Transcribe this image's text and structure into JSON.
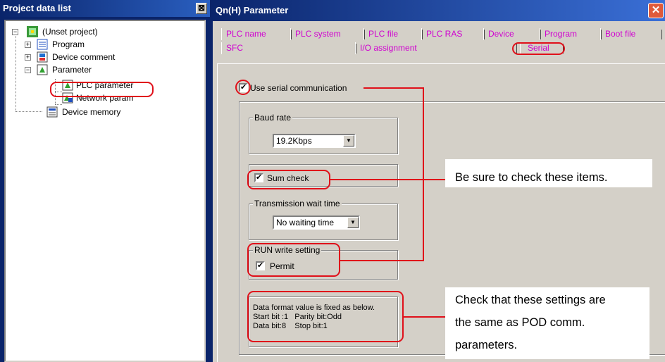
{
  "left_panel": {
    "title": "Project data list",
    "close_glyph": "⊠",
    "tree": [
      {
        "label": "(Unset project)",
        "icon": "project-icon",
        "expander": "−"
      },
      {
        "label": "Program",
        "icon": "program-icon",
        "expander": "+"
      },
      {
        "label": "Device comment",
        "icon": "device-comment-icon",
        "expander": "+"
      },
      {
        "label": "Parameter",
        "icon": "parameter-icon",
        "expander": "−"
      },
      {
        "label": "PLC parameter",
        "icon": "plc-parameter-icon"
      },
      {
        "label": "Network param",
        "icon": "network-param-icon"
      },
      {
        "label": "Device memory",
        "icon": "device-memory-icon"
      }
    ]
  },
  "dialog": {
    "title": "Qn(H) Parameter",
    "close_glyph": "✕",
    "tabs_row1": [
      "PLC name",
      "PLC system",
      "PLC file",
      "PLC RAS",
      "Device",
      "Program",
      "Boot file"
    ],
    "tabs_row2": [
      "SFC",
      "I/O assignment",
      "Serial"
    ],
    "active_tab": "Serial",
    "use_serial_label": "Use serial communication",
    "baud_rate": {
      "group_label": "Baud rate",
      "value": "19.2Kbps"
    },
    "sum_check_label": "Sum check",
    "transmission_wait": {
      "group_label": "Transmission wait time",
      "value": "No waiting time"
    },
    "run_write": {
      "group_label": "RUN write setting",
      "permit_label": "Permit"
    },
    "data_format": {
      "line1": "Data format value is fixed as below.",
      "line2": "Start bit :1   Parity bit:Odd",
      "line3": "Data bit:8    Stop bit:1"
    }
  },
  "annotations": {
    "note_check_items": "Be sure to check these items.",
    "note_settings_1": "Check that these settings are",
    "note_settings_2": "the same as POD comm.",
    "note_settings_3": "parameters.",
    "accent_color": "#e0101a",
    "tab_text_color": "#d000d0"
  }
}
